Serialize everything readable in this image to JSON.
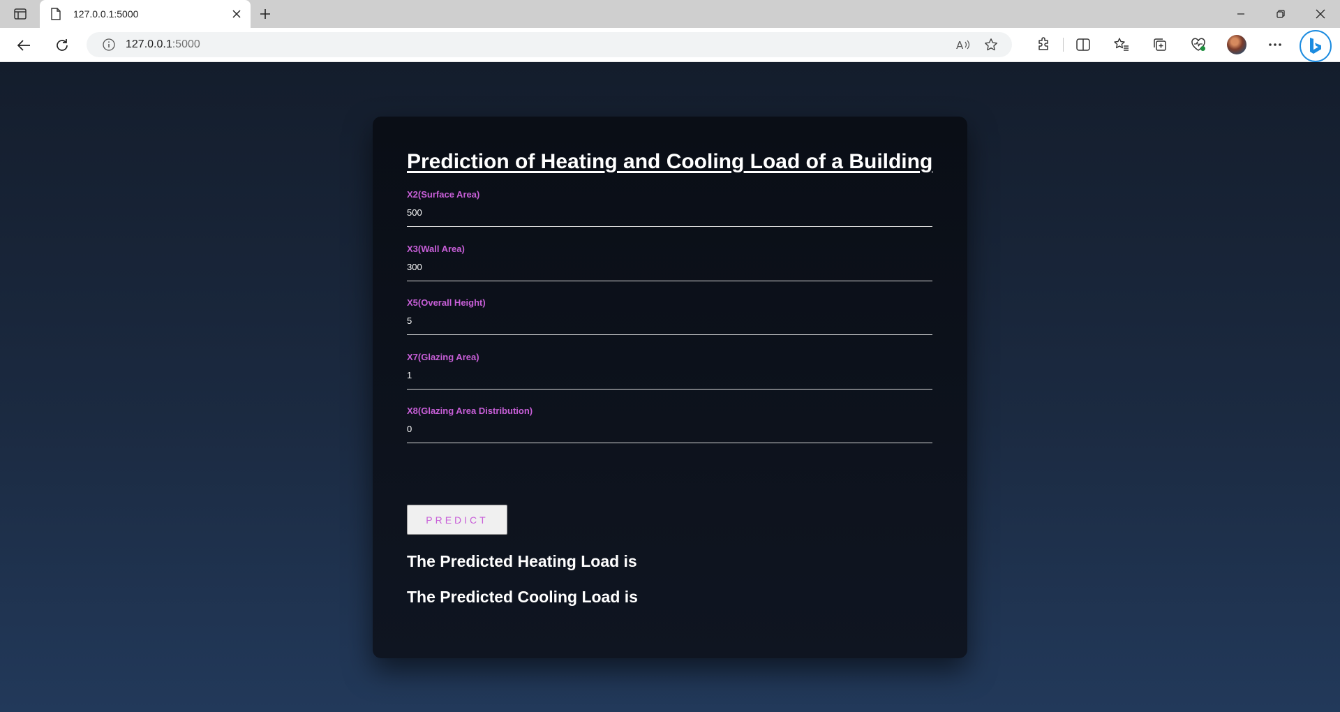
{
  "browser": {
    "tab_title": "127.0.0.1:5000",
    "url_host": "127.0.0.1",
    "url_port": ":5000"
  },
  "page": {
    "title": "Prediction of Heating and Cooling Load of a Building",
    "fields": [
      {
        "label": "X2(Surface Area)",
        "value": "500"
      },
      {
        "label": "X3(Wall Area)",
        "value": "300"
      },
      {
        "label": "X5(Overall Height)",
        "value": "5"
      },
      {
        "label": "X7(Glazing Area)",
        "value": "1"
      },
      {
        "label": "X8(Glazing Area Distribution)",
        "value": "0"
      }
    ],
    "predict_label": "PREDICT",
    "heating_result": "The Predicted Heating Load is",
    "cooling_result": "The Predicted Cooling Load is"
  },
  "colors": {
    "accent": "#c85fd8",
    "card_bg": "#0d121c",
    "page_bg": "#1b2a41"
  }
}
